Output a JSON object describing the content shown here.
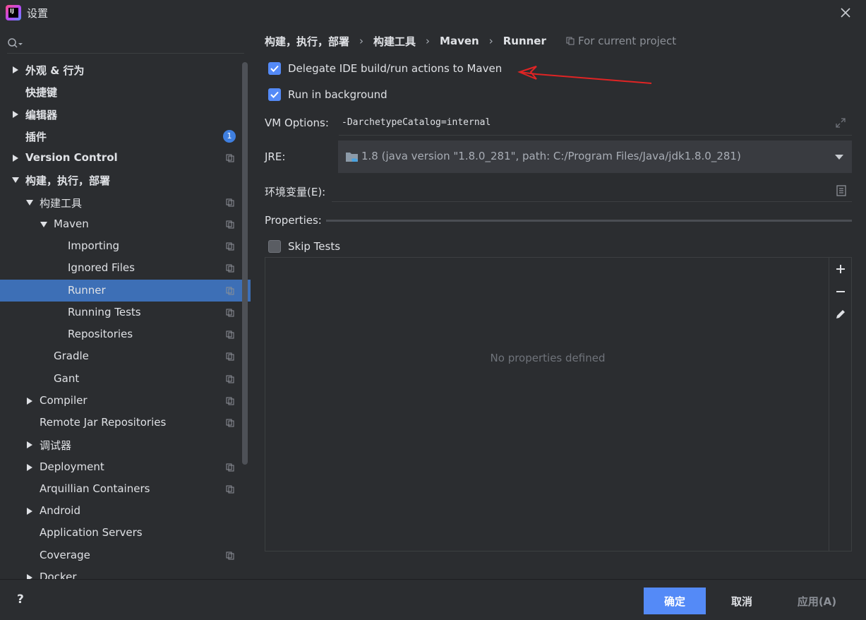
{
  "window": {
    "title": "设置"
  },
  "sidebar": {
    "items": [
      {
        "label": "外观 & 行为",
        "expander": "right",
        "bold": true,
        "indent": 0,
        "icon": ""
      },
      {
        "label": "快捷键",
        "expander": "",
        "bold": true,
        "indent": 0,
        "icon": ""
      },
      {
        "label": "编辑器",
        "expander": "right",
        "bold": true,
        "indent": 0,
        "icon": ""
      },
      {
        "label": "插件",
        "expander": "",
        "bold": true,
        "indent": 0,
        "icon": "badge",
        "badge": "1"
      },
      {
        "label": "Version Control",
        "expander": "right",
        "bold": true,
        "indent": 0,
        "icon": "copy"
      },
      {
        "label": "构建，执行，部署",
        "expander": "down",
        "bold": true,
        "indent": 0,
        "icon": ""
      },
      {
        "label": "构建工具",
        "expander": "down",
        "bold": false,
        "indent": 1,
        "icon": "copy"
      },
      {
        "label": "Maven",
        "expander": "down",
        "bold": false,
        "indent": 2,
        "icon": "copy"
      },
      {
        "label": "Importing",
        "expander": "",
        "bold": false,
        "indent": 3,
        "icon": "copy"
      },
      {
        "label": "Ignored Files",
        "expander": "",
        "bold": false,
        "indent": 3,
        "icon": "copy"
      },
      {
        "label": "Runner",
        "expander": "",
        "bold": false,
        "indent": 3,
        "icon": "copy",
        "selected": true
      },
      {
        "label": "Running Tests",
        "expander": "",
        "bold": false,
        "indent": 3,
        "icon": "copy"
      },
      {
        "label": "Repositories",
        "expander": "",
        "bold": false,
        "indent": 3,
        "icon": "copy"
      },
      {
        "label": "Gradle",
        "expander": "",
        "bold": false,
        "indent": 2,
        "icon": "copy"
      },
      {
        "label": "Gant",
        "expander": "",
        "bold": false,
        "indent": 2,
        "icon": "copy"
      },
      {
        "label": "Compiler",
        "expander": "right",
        "bold": false,
        "indent": 1,
        "icon": "copy"
      },
      {
        "label": "Remote Jar Repositories",
        "expander": "",
        "bold": false,
        "indent": 1,
        "icon": "copy"
      },
      {
        "label": "调试器",
        "expander": "right",
        "bold": false,
        "indent": 1,
        "icon": ""
      },
      {
        "label": "Deployment",
        "expander": "right",
        "bold": false,
        "indent": 1,
        "icon": "copy"
      },
      {
        "label": "Arquillian Containers",
        "expander": "",
        "bold": false,
        "indent": 1,
        "icon": "copy"
      },
      {
        "label": "Android",
        "expander": "right",
        "bold": false,
        "indent": 1,
        "icon": ""
      },
      {
        "label": "Application Servers",
        "expander": "",
        "bold": false,
        "indent": 1,
        "icon": ""
      },
      {
        "label": "Coverage",
        "expander": "",
        "bold": false,
        "indent": 1,
        "icon": "copy"
      },
      {
        "label": "Docker",
        "expander": "right",
        "bold": false,
        "indent": 1,
        "icon": ""
      }
    ]
  },
  "breadcrumb": {
    "part1": "构建，执行，部署",
    "part2": "构建工具",
    "part3": "Maven",
    "part4": "Runner",
    "separator": "›"
  },
  "scope": {
    "label": "For current project"
  },
  "options": {
    "delegate_label": "Delegate IDE build/run actions to Maven",
    "delegate_checked": true,
    "background_label": "Run in background",
    "background_checked": true,
    "vm_label": "VM Options:",
    "vm_value": "-DarchetypeCatalog=internal",
    "jre_label": "JRE:",
    "jre_value": "1.8 (java version \"1.8.0_281\", path: C:/Program Files/Java/jdk1.8.0_281)",
    "env_label": "环境变量(E):",
    "env_value": "",
    "properties_label": "Properties:",
    "skip_tests_label": "Skip Tests",
    "skip_tests_checked": false,
    "empty_properties": "No properties defined"
  },
  "footer": {
    "help": "?",
    "ok": "确定",
    "cancel": "取消",
    "apply": "应用(A)"
  },
  "colors": {
    "accent": "#548af7",
    "selection": "#3d6fb6",
    "annotation_arrow": "#e02424"
  }
}
